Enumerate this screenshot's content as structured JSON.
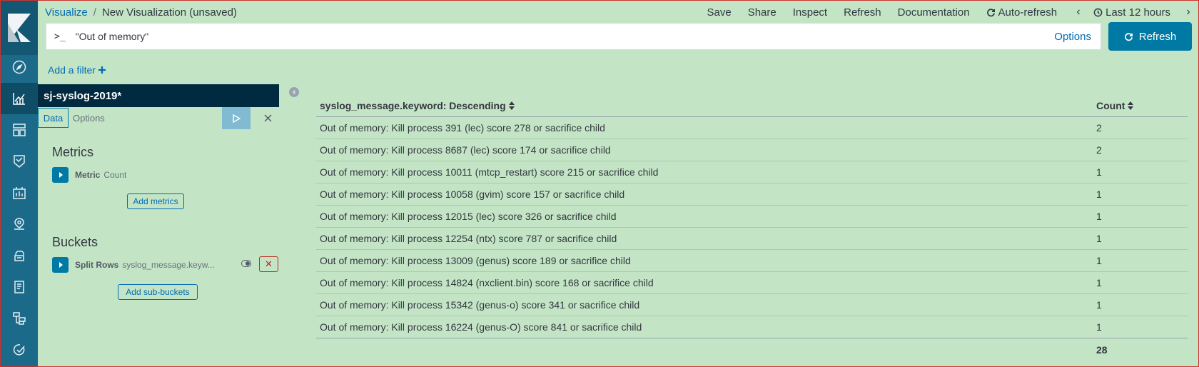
{
  "breadcrumb": {
    "app": "Visualize",
    "separator": "/",
    "current": "New Visualization (unsaved)"
  },
  "menu": {
    "save": "Save",
    "share": "Share",
    "inspect": "Inspect",
    "refresh": "Refresh",
    "documentation": "Documentation",
    "auto_refresh": "Auto-refresh",
    "time_range": "Last 12 hours"
  },
  "query": {
    "prompt": ">_",
    "value": "\"Out of memory\"",
    "options": "Options"
  },
  "refresh_button": "Refresh",
  "add_filter": "Add a filter",
  "sidebar": {
    "index_pattern": "sj-syslog-2019*",
    "tabs": {
      "data": "Data",
      "options": "Options"
    },
    "metrics": {
      "title": "Metrics",
      "items": [
        {
          "label": "Metric",
          "desc": "Count"
        }
      ],
      "add_button": "Add metrics"
    },
    "buckets": {
      "title": "Buckets",
      "items": [
        {
          "label": "Split Rows",
          "desc": "syslog_message.keyw..."
        }
      ],
      "add_button": "Add sub-buckets"
    }
  },
  "table": {
    "columns": [
      "syslog_message.keyword: Descending",
      "Count"
    ],
    "rows": [
      [
        "Out of memory: Kill process 391 (lec) score 278 or sacrifice child",
        "2"
      ],
      [
        "Out of memory: Kill process 8687 (lec) score 174 or sacrifice child",
        "2"
      ],
      [
        "Out of memory: Kill process 10011 (mtcp_restart) score 215 or sacrifice child",
        "1"
      ],
      [
        "Out of memory: Kill process 10058 (gvim) score 157 or sacrifice child",
        "1"
      ],
      [
        "Out of memory: Kill process 12015 (lec) score 326 or sacrifice child",
        "1"
      ],
      [
        "Out of memory: Kill process 12254 (ntx) score 787 or sacrifice child",
        "1"
      ],
      [
        "Out of memory: Kill process 13009 (genus) score 189 or sacrifice child",
        "1"
      ],
      [
        "Out of memory: Kill process 14824 (nxclient.bin) score 168 or sacrifice child",
        "1"
      ],
      [
        "Out of memory: Kill process 15342 (genus-o) score 341 or sacrifice child",
        "1"
      ],
      [
        "Out of memory: Kill process 16224 (genus-O) score 841 or sacrifice child",
        "1"
      ]
    ],
    "total": "28"
  },
  "colors": {
    "background": "#c3e5c5",
    "nav": "#1b6a8a",
    "accent": "#006bb4",
    "index_bar": "#002a40",
    "danger": "#bd271e"
  },
  "nav_icons": [
    "discover-icon",
    "visualize-icon",
    "dashboard-icon",
    "timelion-icon",
    "canvas-icon",
    "maps-icon",
    "infrastructure-icon",
    "logs-icon",
    "apm-icon",
    "uptime-icon"
  ]
}
